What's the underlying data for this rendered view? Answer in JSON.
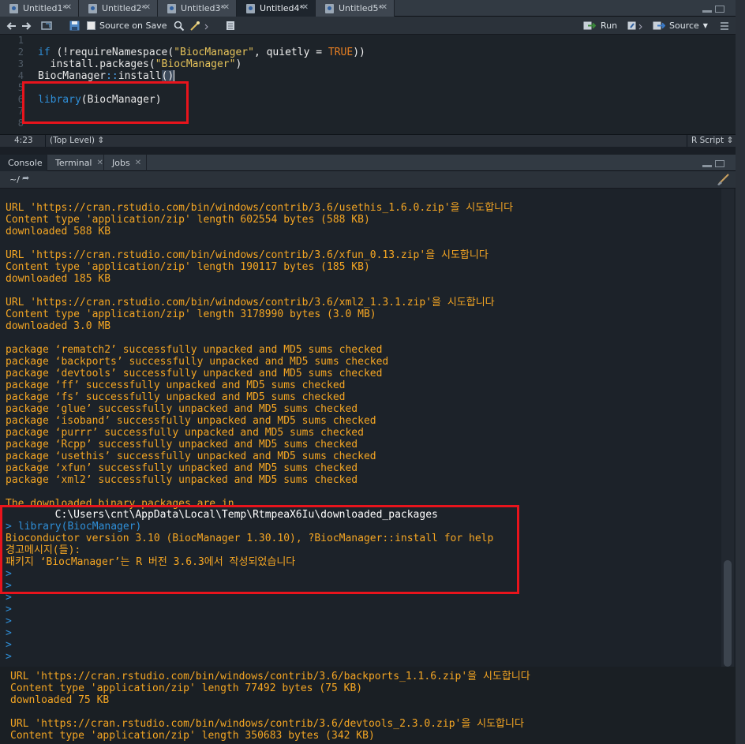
{
  "editor_tabs": [
    {
      "label": "Untitled1*"
    },
    {
      "label": "Untitled2*"
    },
    {
      "label": "Untitled3*"
    },
    {
      "label": "Untitled4*"
    },
    {
      "label": "Untitled5*"
    }
  ],
  "editor_toolbar": {
    "source_on_save": "Source on Save",
    "run": "Run",
    "source": "Source"
  },
  "code_lines": [
    {
      "num": "1"
    },
    {
      "num": "2",
      "parts": [
        "if",
        " (!",
        "requireNamespace",
        "(",
        "\"BiocManager\"",
        ", quietly = ",
        "TRUE",
        "))"
      ]
    },
    {
      "num": "3",
      "parts": [
        "  ",
        "install.packages",
        "(",
        "\"BiocManager\"",
        ")"
      ]
    },
    {
      "num": "4",
      "parts": [
        "BiocManager",
        "::",
        "install",
        "(",
        ")"
      ]
    },
    {
      "num": "5"
    },
    {
      "num": "6",
      "parts": [
        "library",
        "(",
        "BiocManager",
        ")"
      ]
    },
    {
      "num": "7"
    },
    {
      "num": "8"
    }
  ],
  "editor_status": {
    "position": "4:23",
    "scope": "(Top Level)",
    "file_type": "R Script"
  },
  "console_tabs": [
    {
      "label": "Console"
    },
    {
      "label": "Terminal"
    },
    {
      "label": "Jobs"
    }
  ],
  "console_path": "~/",
  "console_lines": [
    "URL 'https://cran.rstudio.com/bin/windows/contrib/3.6/usethis_1.6.0.zip'을 시도합니다",
    "Content type 'application/zip' length 602554 bytes (588 KB)",
    "downloaded 588 KB",
    "",
    "URL 'https://cran.rstudio.com/bin/windows/contrib/3.6/xfun_0.13.zip'을 시도합니다",
    "Content type 'application/zip' length 190117 bytes (185 KB)",
    "downloaded 185 KB",
    "",
    "URL 'https://cran.rstudio.com/bin/windows/contrib/3.6/xml2_1.3.1.zip'을 시도합니다",
    "Content type 'application/zip' length 3178990 bytes (3.0 MB)",
    "downloaded 3.0 MB",
    "",
    "package ‘rematch2’ successfully unpacked and MD5 sums checked",
    "package ‘backports’ successfully unpacked and MD5 sums checked",
    "package ‘devtools’ successfully unpacked and MD5 sums checked",
    "package ‘ff’ successfully unpacked and MD5 sums checked",
    "package ‘fs’ successfully unpacked and MD5 sums checked",
    "package ‘glue’ successfully unpacked and MD5 sums checked",
    "package ‘isoband’ successfully unpacked and MD5 sums checked",
    "package ‘purrr’ successfully unpacked and MD5 sums checked",
    "package ‘Rcpp’ successfully unpacked and MD5 sums checked",
    "package ‘usethis’ successfully unpacked and MD5 sums checked",
    "package ‘xfun’ successfully unpacked and MD5 sums checked",
    "package ‘xml2’ successfully unpacked and MD5 sums checked",
    "",
    "The downloaded binary packages are in"
  ],
  "console_highlight": {
    "path_line": "        C:\\Users\\cnt\\AppData\\Local\\Temp\\RtmpeaX6Iu\\downloaded_packages",
    "prompt": ">",
    "command": "library(BiocManager)",
    "lines": [
      "Bioconductor version 3.10 (BiocManager 1.30.10), ?BiocManager::install for help",
      "경고메시지(들):",
      "패키지 ‘BiocManager’는 R 버전 3.6.3에서 작성되었습니다"
    ]
  },
  "console_prompts": [
    ">",
    ">",
    ">",
    ">",
    ">",
    ">",
    ">",
    ">"
  ],
  "overlay_lines": [
    "URL 'https://cran.rstudio.com/bin/windows/contrib/3.6/backports_1.1.6.zip'을 시도합니다",
    "Content type 'application/zip' length 77492 bytes (75 KB)",
    "downloaded 75 KB",
    "",
    "URL 'https://cran.rstudio.com/bin/windows/contrib/3.6/devtools_2.3.0.zip'을 시도합니다",
    "Content type 'application/zip' length 350683 bytes (342 KB)"
  ],
  "colors": {
    "output": "#f5a623",
    "prompt": "#2f8fd8",
    "annotation": "#e8141c"
  }
}
